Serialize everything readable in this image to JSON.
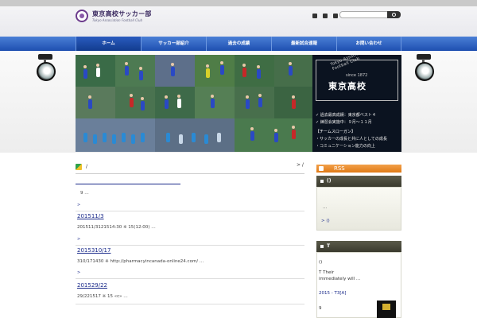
{
  "site": {
    "title": "東京高校サッカー部",
    "subtitle": "Tokyo Association Football Club"
  },
  "search": {
    "placeholder": ""
  },
  "nav": {
    "items": [
      {
        "label": "ホーム",
        "active": true
      },
      {
        "label": "サッカー部紹介",
        "active": false
      },
      {
        "label": "過去の成績",
        "active": false
      },
      {
        "label": "最新試合速報",
        "active": false
      },
      {
        "label": "お問い合わせ",
        "active": false
      }
    ]
  },
  "hero": {
    "club_arc": "Tokyo Association Football Club",
    "since": "since 1872",
    "school_name": "東京高校",
    "lines": [
      "✓ 過去最高成績：東京都ベスト４",
      "✓ 練習会実施中：９月～１１月",
      "【チームスローガン】",
      "・サッカーの成長と共に人としての成長",
      "・コミュニケーション能力の向上"
    ]
  },
  "breadcrumb": {
    "sep": "/",
    "right": "> /"
  },
  "main": {
    "intro": "9 …",
    "arrow": ">",
    "posts": [
      {
        "title": "201511/3",
        "excerpt": "201511/3121514:30 ※ 15(12:00) …"
      },
      {
        "title": "2015310/17",
        "excerpt": "310/171430 ※ http://pharmacyincanada-online24.com/  …"
      },
      {
        "title": "201529/22",
        "excerpt": "29/221517 ※ 15 «c» …"
      }
    ]
  },
  "sidebar": {
    "rss_label": "RSS",
    "widget1": {
      "heading": "()",
      "text": "…",
      "link": "> ()"
    },
    "widget2": {
      "heading": "T",
      "lines": [
        "()",
        "T Their",
        "immediately will …",
        "2015 - T3[A]",
        "9"
      ]
    }
  }
}
